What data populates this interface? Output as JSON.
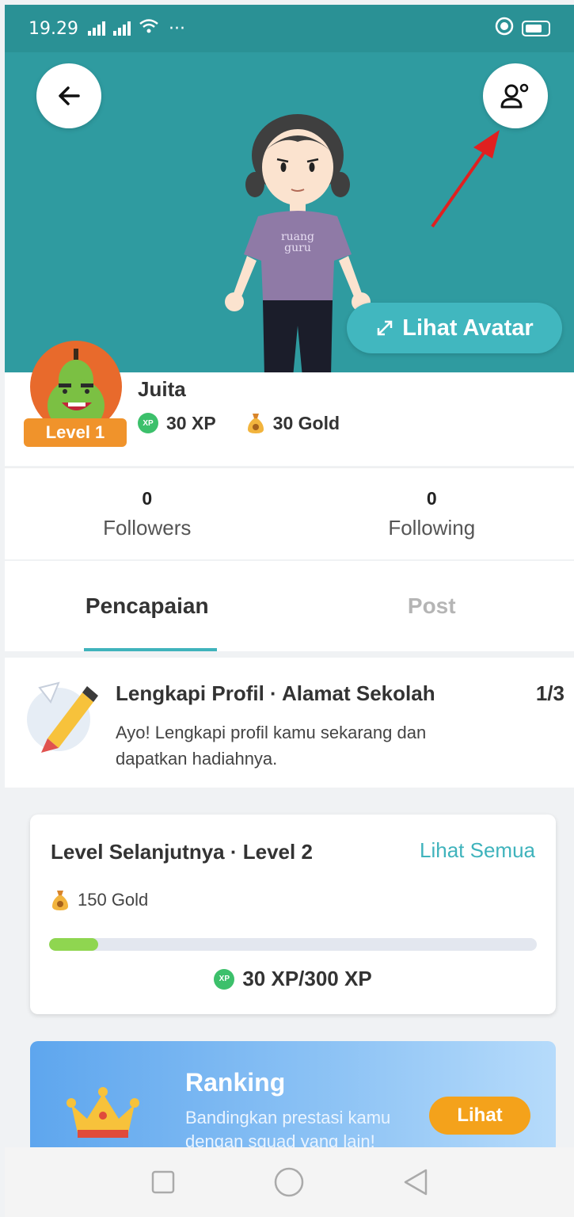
{
  "status_bar": {
    "time": "19.29",
    "extra": "···"
  },
  "hero": {
    "view_avatar_label": "Lihat Avatar",
    "shirt_text": "ruang guru"
  },
  "profile": {
    "name": "Juita",
    "level_badge": "Level 1",
    "xp": "30 XP",
    "gold": "30 Gold",
    "xp_icon_text": "XP"
  },
  "follow": {
    "followers_count": "0",
    "followers_label": "Followers",
    "following_count": "0",
    "following_label": "Following"
  },
  "tabs": [
    {
      "label": "Pencapaian",
      "active": true
    },
    {
      "label": "Post",
      "active": false
    }
  ],
  "achievement": {
    "title": "Lengkapi Profil · Alamat Sekolah",
    "count": "1/3",
    "description": "Ayo! Lengkapi profil kamu sekarang dan dapatkan hadiahnya."
  },
  "next_level": {
    "title": "Level Selanjutnya · Level 2",
    "see_all": "Lihat Semua",
    "reward": "150 Gold",
    "progress_text": "30 XP/300 XP",
    "progress_fraction": 0.1
  },
  "ranking": {
    "title": "Ranking",
    "description": "Bandingkan prestasi kamu dengan squad yang lain!",
    "button": "Lihat"
  },
  "colors": {
    "hero_bg": "#2f9ba0",
    "accent": "#3fb3bc",
    "level_badge": "#f0932b",
    "progress_fill": "#8fd650",
    "ranking_btn": "#f4a21b"
  },
  "icons": [
    "back-arrow-icon",
    "people-icon",
    "expand-icon",
    "xp-icon",
    "gold-bag-icon",
    "pencil-icon",
    "crown-icon"
  ]
}
